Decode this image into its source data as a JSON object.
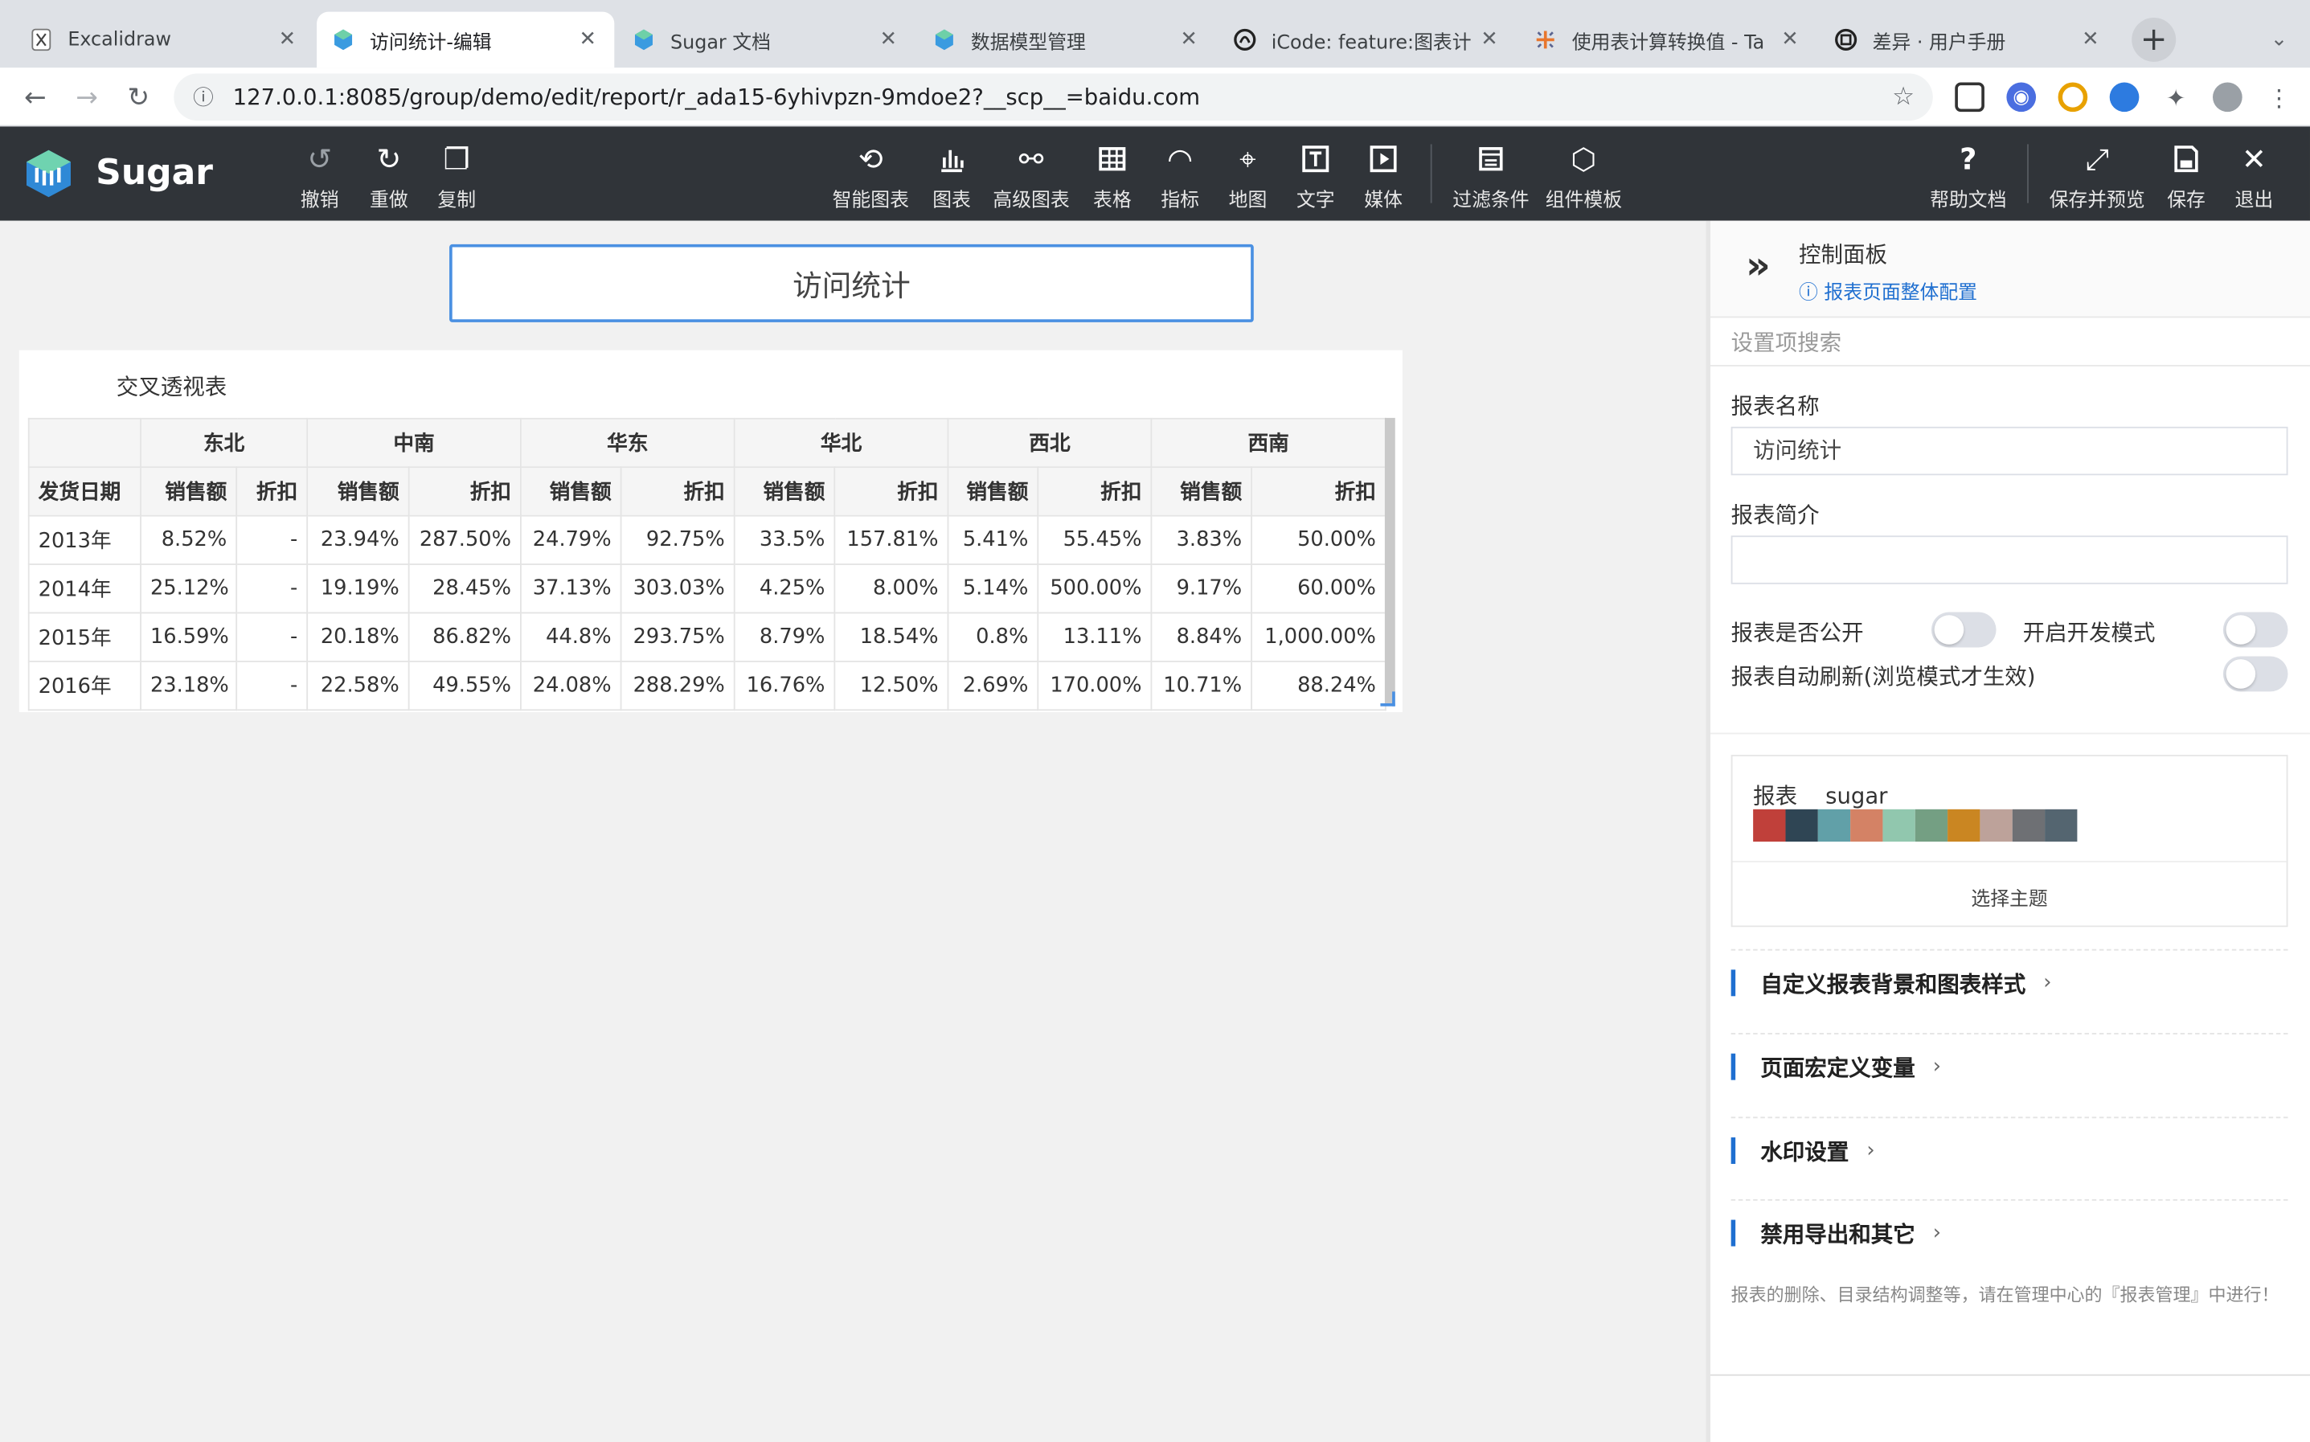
{
  "browser": {
    "tabs": [
      {
        "title": "Excalidraw",
        "icon": "excalidraw-icon"
      },
      {
        "title": "访问统计-编辑",
        "icon": "sugar-icon",
        "active": true
      },
      {
        "title": "Sugar 文档",
        "icon": "sugar-icon"
      },
      {
        "title": "数据模型管理",
        "icon": "sugar-icon"
      },
      {
        "title": "iCode: feature:图表计",
        "icon": "icode-icon"
      },
      {
        "title": "使用表计算转换值 - Ta",
        "icon": "tableau-icon"
      },
      {
        "title": "差异 · 用户手册",
        "icon": "diff-icon"
      }
    ],
    "url": "127.0.0.1:8085/group/demo/edit/report/r_ada15-6yhivpzn-9mdoe2?__scp__=baidu.com"
  },
  "app": {
    "brand": "Sugar",
    "toolbar_left": [
      {
        "label": "撤销",
        "icon": "undo-icon"
      },
      {
        "label": "重做",
        "icon": "redo-icon"
      },
      {
        "label": "复制",
        "icon": "copy-icon"
      }
    ],
    "toolbar_center": [
      {
        "label": "智能图表",
        "icon": "smart-chart-icon"
      },
      {
        "label": "图表",
        "icon": "bar-chart-icon"
      },
      {
        "label": "高级图表",
        "icon": "advanced-chart-icon"
      },
      {
        "label": "表格",
        "icon": "table-icon"
      },
      {
        "label": "指标",
        "icon": "gauge-icon"
      },
      {
        "label": "地图",
        "icon": "map-pin-icon"
      },
      {
        "label": "文字",
        "icon": "text-icon"
      },
      {
        "label": "媒体",
        "icon": "media-icon"
      },
      {
        "label": "过滤条件",
        "icon": "filter-icon"
      },
      {
        "label": "组件模板",
        "icon": "template-icon"
      }
    ],
    "toolbar_right": [
      {
        "label": "帮助文档",
        "icon": "help-icon"
      },
      {
        "label": "保存并预览",
        "icon": "expand-icon"
      },
      {
        "label": "保存",
        "icon": "save-icon"
      },
      {
        "label": "退出",
        "icon": "close-icon"
      }
    ]
  },
  "canvas": {
    "report_title": "访问统计",
    "widget_title": "交叉透视表",
    "table": {
      "row_header": "发货日期",
      "regions": [
        "东北",
        "中南",
        "华东",
        "华北",
        "西北",
        "西南"
      ],
      "measures": [
        "销售额",
        "折扣"
      ],
      "rows": [
        {
          "label": "2013年",
          "cells": [
            "8.52%",
            "-",
            "23.94%",
            "287.50%",
            "24.79%",
            "92.75%",
            "33.5%",
            "157.81%",
            "5.41%",
            "55.45%",
            "3.83%",
            "50.00%"
          ]
        },
        {
          "label": "2014年",
          "cells": [
            "25.12%",
            "-",
            "19.19%",
            "28.45%",
            "37.13%",
            "303.03%",
            "4.25%",
            "8.00%",
            "5.14%",
            "500.00%",
            "9.17%",
            "60.00%"
          ]
        },
        {
          "label": "2015年",
          "cells": [
            "16.59%",
            "-",
            "20.18%",
            "86.82%",
            "44.8%",
            "293.75%",
            "8.79%",
            "18.54%",
            "0.8%",
            "13.11%",
            "8.84%",
            "1,000.00%"
          ]
        },
        {
          "label": "2016年",
          "cells": [
            "23.18%",
            "-",
            "22.58%",
            "49.55%",
            "24.08%",
            "288.29%",
            "16.76%",
            "12.50%",
            "2.69%",
            "170.00%",
            "10.71%",
            "88.24%"
          ]
        }
      ]
    }
  },
  "panel": {
    "title": "控制面板",
    "config_link": "报表页面整体配置",
    "search_placeholder": "设置项搜索",
    "name_label": "报表名称",
    "name_value": "访问统计",
    "desc_label": "报表简介",
    "desc_value": "",
    "public_label": "报表是否公开",
    "public_on": false,
    "dev_label": "开启开发模式",
    "dev_on": false,
    "refresh_label": "报表自动刷新(浏览模式才生效)",
    "refresh_on": false,
    "theme_label": "报表",
    "theme_name": "sugar",
    "theme_colors": [
      "#c0403a",
      "#2f4554",
      "#61a0a8",
      "#d48265",
      "#91c7ae",
      "#749f83",
      "#ca8622",
      "#bda29a",
      "#6e7074",
      "#546570"
    ],
    "choose_theme": "选择主题",
    "sections": [
      "自定义报表背景和图表样式",
      "页面宏定义变量",
      "水印设置",
      "禁用导出和其它"
    ],
    "note": "报表的删除、目录结构调整等，请在管理中心的『报表管理』中进行！"
  }
}
